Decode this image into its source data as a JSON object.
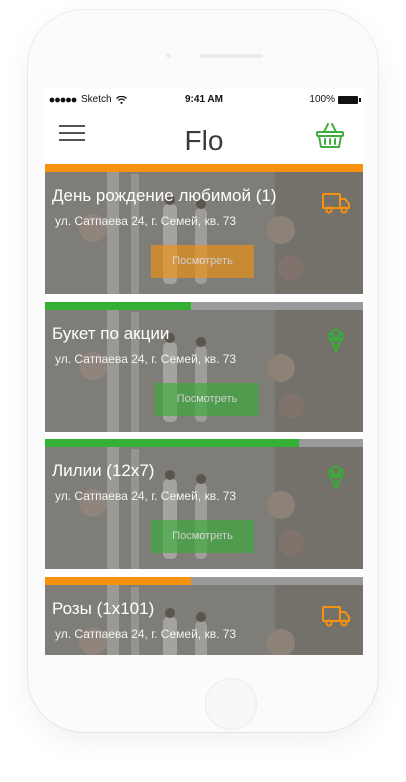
{
  "status_bar": {
    "carrier": "Sketch",
    "time": "9:41 AM",
    "battery": "100%"
  },
  "header": {
    "title": "Flo"
  },
  "colors": {
    "accent_orange": "#f7920e",
    "accent_green": "#34b035",
    "track": "#9a9a9a"
  },
  "orders": [
    {
      "title": "День рождение любимой (1)",
      "address": "ул. Сатпаева 24, г. Семей, кв. 73",
      "button_label": "Посмотреть",
      "status_icon": "truck-icon",
      "progress": 1.0,
      "color": "#f7920e"
    },
    {
      "title": "Букет по акции",
      "address": "ул. Сатпаева 24, г. Семей, кв. 73",
      "button_label": "Посмотреть",
      "status_icon": "flower-bouquet-icon",
      "progress": 0.46,
      "color": "#34b035"
    },
    {
      "title": "Лилии (12х7)",
      "address": "ул. Сатпаева 24, г. Семей, кв. 73",
      "button_label": "Посмотреть",
      "status_icon": "flower-bouquet-icon",
      "progress": 0.8,
      "color": "#34b035"
    },
    {
      "title": "Розы  (1х101)",
      "address": "ул. Сатпаева 24, г. Семей, кв. 73",
      "button_label": "",
      "status_icon": "truck-icon",
      "progress": 0.46,
      "color": "#f7920e"
    }
  ]
}
